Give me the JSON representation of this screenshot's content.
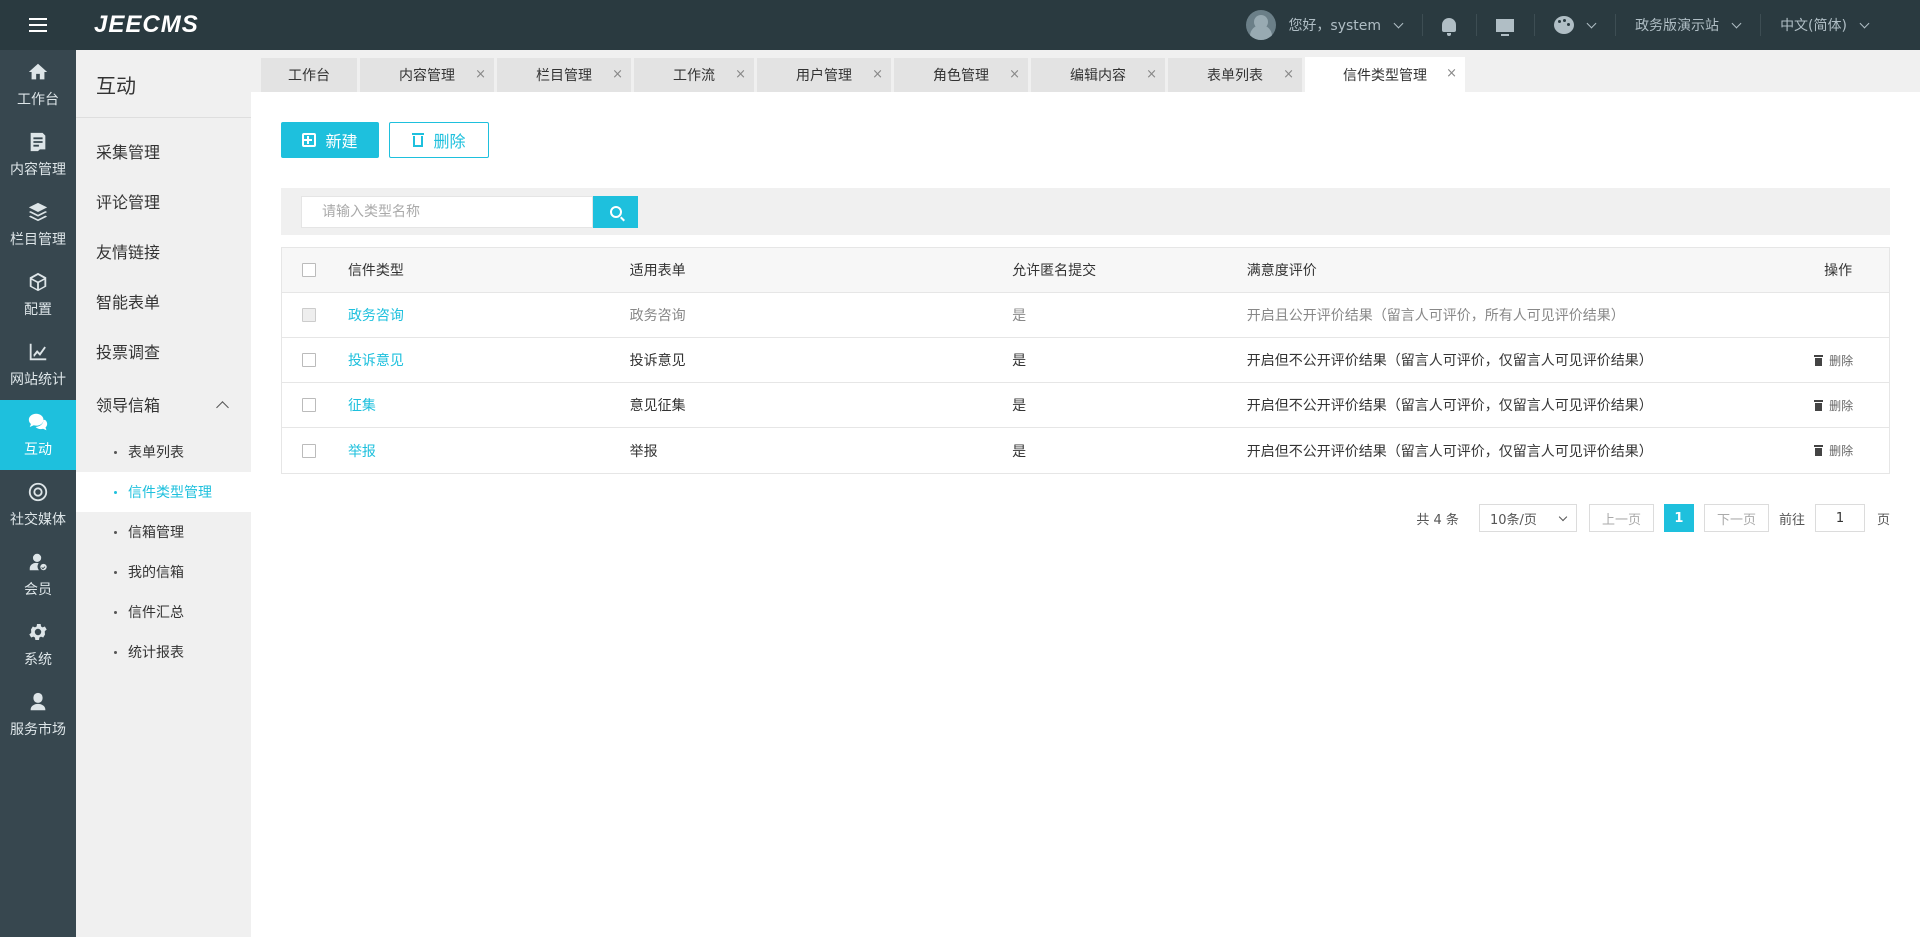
{
  "app": {
    "logo": "JEECMS"
  },
  "topbar": {
    "greeting": "您好，system",
    "site": "政务版演示站",
    "language": "中文(简体)"
  },
  "rail": [
    {
      "label": "工作台",
      "icon": "home-icon"
    },
    {
      "label": "内容管理",
      "icon": "document-icon"
    },
    {
      "label": "栏目管理",
      "icon": "layers-icon"
    },
    {
      "label": "配置",
      "icon": "cube-icon"
    },
    {
      "label": "网站统计",
      "icon": "chart-line-icon"
    },
    {
      "label": "互动",
      "icon": "chat-icon"
    },
    {
      "label": "社交媒体",
      "icon": "target-icon"
    },
    {
      "label": "会员",
      "icon": "member-icon"
    },
    {
      "label": "系统",
      "icon": "gear-icon"
    },
    {
      "label": "服务市场",
      "icon": "service-icon"
    }
  ],
  "subnav": {
    "title": "互动",
    "items": [
      "采集管理",
      "评论管理",
      "友情链接",
      "智能表单",
      "投票调查"
    ],
    "open_group": "领导信箱",
    "sub_items": [
      "表单列表",
      "信件类型管理",
      "信箱管理",
      "我的信箱",
      "信件汇总",
      "统计报表"
    ]
  },
  "tabs": [
    {
      "label": "工作台"
    },
    {
      "label": "内容管理"
    },
    {
      "label": "栏目管理"
    },
    {
      "label": "工作流"
    },
    {
      "label": "用户管理"
    },
    {
      "label": "角色管理"
    },
    {
      "label": "编辑内容"
    },
    {
      "label": "表单列表"
    },
    {
      "label": "信件类型管理"
    }
  ],
  "tab_close": "×",
  "toolbar": {
    "new_label": "新建",
    "delete_label": "删除"
  },
  "search": {
    "placeholder": "请输入类型名称"
  },
  "table": {
    "headers": [
      "信件类型",
      "适用表单",
      "允许匿名提交",
      "满意度评价",
      "操作"
    ],
    "rows": [
      {
        "type": "政务咨询",
        "form": "政务咨询",
        "anonymous": "是",
        "rating": "开启且公开评价结果（留言人可评价，所有人可见评价结果）",
        "action": ""
      },
      {
        "type": "投诉意见",
        "form": "投诉意见",
        "anonymous": "是",
        "rating": "开启但不公开评价结果（留言人可评价，仅留言人可见评价结果）",
        "action": "删除"
      },
      {
        "type": "征集",
        "form": "意见征集",
        "anonymous": "是",
        "rating": "开启但不公开评价结果（留言人可评价，仅留言人可见评价结果）",
        "action": "删除"
      },
      {
        "type": "举报",
        "form": "举报",
        "anonymous": "是",
        "rating": "开启但不公开评价结果（留言人可评价，仅留言人可见评价结果）",
        "action": "删除"
      }
    ]
  },
  "pager": {
    "total": "共 4 条",
    "page_size": "10条/页",
    "prev": "上一页",
    "current": "1",
    "next": "下一页",
    "goto": "前往",
    "goto_value": "1",
    "unit": "页"
  },
  "colors": {
    "accent": "#1ec0dd",
    "topbar": "#2a3a40",
    "rail": "#37474f"
  }
}
